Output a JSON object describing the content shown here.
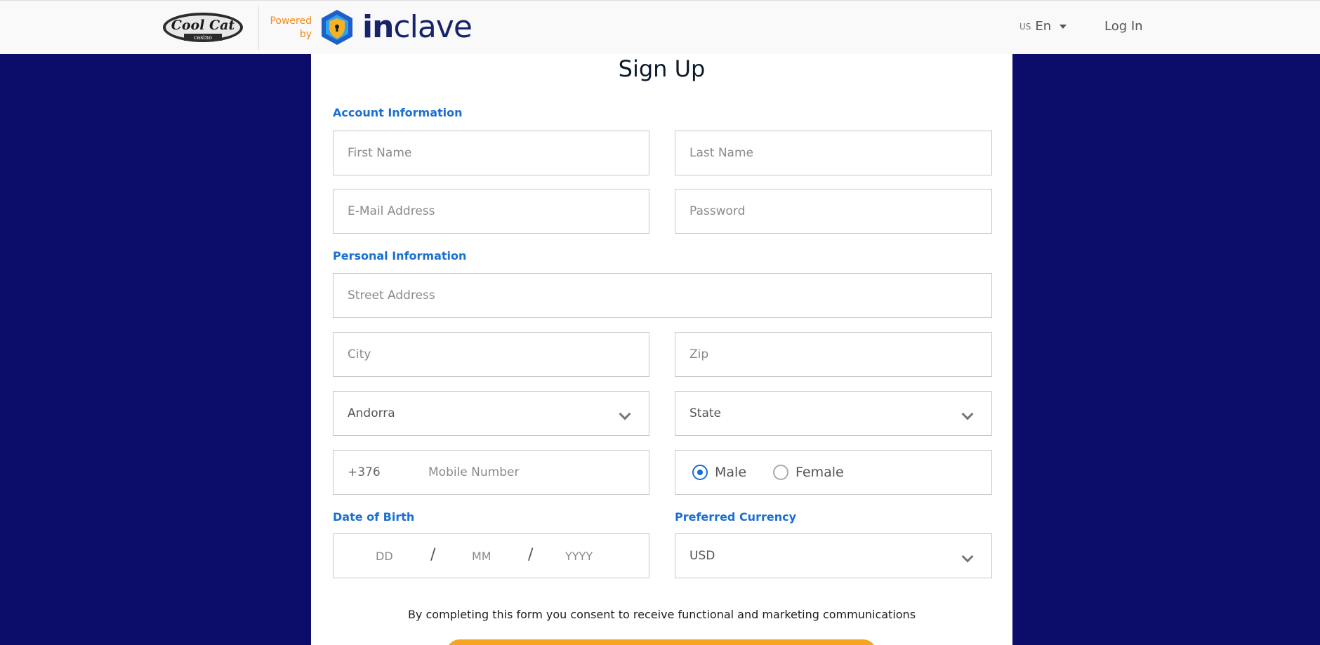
{
  "header": {
    "brand_lines": [
      "Cool Cat",
      "casino"
    ],
    "powered_by": [
      "Powered",
      "by"
    ],
    "inclave_bold": "in",
    "inclave_light": "clave",
    "lang_country": "US",
    "lang_label": "En",
    "login_label": "Log In"
  },
  "form": {
    "title": "Sign Up",
    "account_section": "Account Information",
    "first_name_placeholder": "First Name",
    "last_name_placeholder": "Last Name",
    "email_placeholder": "E-Mail Address",
    "password_placeholder": "Password",
    "personal_section": "Personal Information",
    "street_placeholder": "Street Address",
    "city_placeholder": "City",
    "zip_placeholder": "Zip",
    "country_value": "Andorra",
    "state_value": "State",
    "phone_prefix": "+376",
    "mobile_placeholder": "Mobile Number",
    "gender_options": [
      "Male",
      "Female"
    ],
    "gender_selected": "Male",
    "dob_label": "Date of Birth",
    "dob_dd": "DD",
    "dob_mm": "MM",
    "dob_yyyy": "YYYY",
    "dob_separator": "/",
    "currency_label": "Preferred Currency",
    "currency_value": "USD",
    "consent_text": "By completing this form you consent to receive functional and marketing communications"
  },
  "colors": {
    "page_background": "#0c0d6b",
    "accent_blue": "#1a6fd1",
    "orange": "#f7a521"
  }
}
